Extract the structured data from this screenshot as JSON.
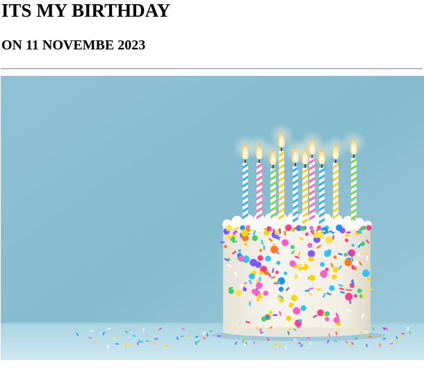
{
  "page": {
    "title": "ITS MY BIRTHDAY",
    "subtitle": "ON 11 NOVEMBE 2023"
  },
  "photo": {
    "subject": "birthday-cake-with-candles-icon",
    "colors": {
      "background": "#8ec3d6",
      "table": "#bfe0ea",
      "frosting": "#f4f1e8"
    }
  }
}
